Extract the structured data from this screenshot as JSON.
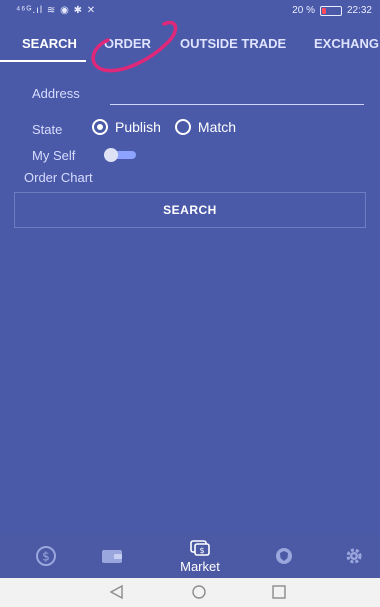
{
  "status_bar": {
    "left_indicators": "⁴⁶ᴳ.ıl ≋ ◉ ✱ ✕",
    "battery_percent": "20 %",
    "battery_level": 0.2,
    "time": "22:32"
  },
  "tabs": [
    {
      "label": "SEARCH",
      "active": true
    },
    {
      "label": "ORDER",
      "active": false
    },
    {
      "label": "OUTSIDE TRADE",
      "active": false
    },
    {
      "label": "EXCHANG",
      "active": false
    }
  ],
  "form": {
    "address_label": "Address",
    "address_value": "",
    "state_label": "State",
    "state_options": [
      {
        "label": "Publish",
        "selected": true
      },
      {
        "label": "Match",
        "selected": false
      }
    ],
    "myself_label": "My Self",
    "myself_on": false,
    "order_chart_label": "Order Chart",
    "search_button": "SEARCH"
  },
  "bottom_nav": {
    "items": [
      {
        "icon": "dollar-coin-icon"
      },
      {
        "icon": "wallet-icon"
      },
      {
        "icon": "market-chat-icon",
        "label": "Market"
      },
      {
        "icon": "shield-icon"
      },
      {
        "icon": "gear-icon"
      }
    ],
    "market_label": "Market"
  },
  "colors": {
    "background": "#4a5aa8",
    "annotation": "#e0287a",
    "toggle_track": "#8ea3ff"
  }
}
